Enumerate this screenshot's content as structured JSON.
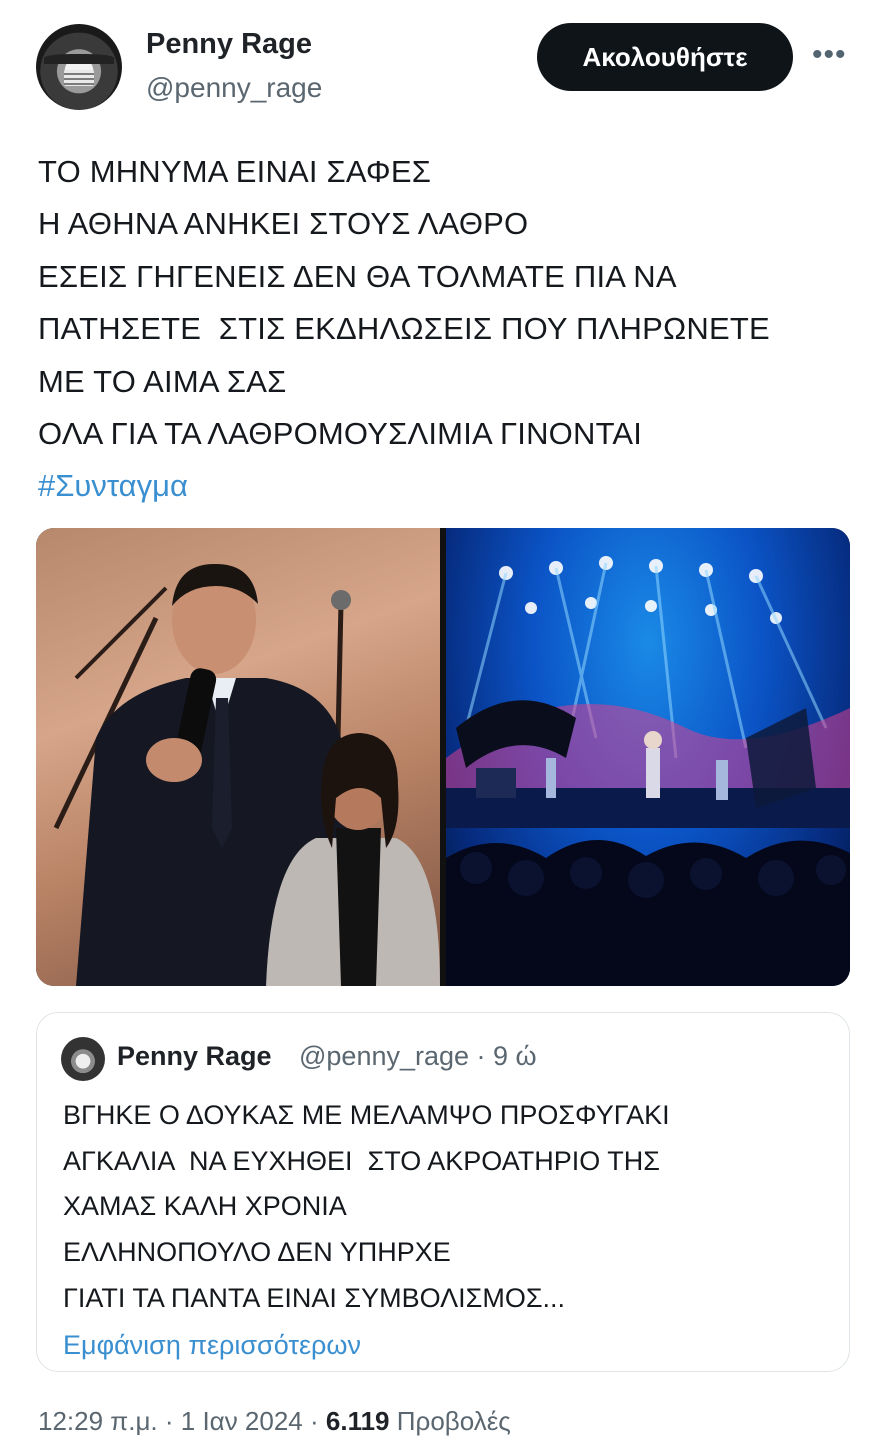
{
  "author": {
    "display_name": "Penny Rage",
    "handle": "@penny_rage",
    "follow_label": "Ακολουθήστε",
    "more_icon": "more-horizontal-icon"
  },
  "tweet": {
    "lines": [
      "ΤΟ ΜΗΝΥΜΑ ΕΙΝΑΙ ΣΑΦΕΣ",
      "Η ΑΘΗΝΑ ΑΝΗΚΕΙ ΣΤΟΥΣ ΛΑΘΡΟ",
      "ΕΣΕΙΣ ΓΗΓΕΝΕΙΣ ΔΕΝ ΘΑ ΤΟΛΜΑΤΕ ΠΙΑ ΝΑ",
      "ΠΑΤΗΣΕΤΕ  ΣΤΙΣ ΕΚΔΗΛΩΣΕΙΣ ΠΟΥ ΠΛΗΡΩΝΕΤΕ",
      "ΜΕ ΤΟ ΑΙΜΑ ΣΑΣ",
      "ΟΛΑ ΓΙΑ ΤΑ ΛΑΘΡΟΜΟΥΣΛΙΜΙΑ ΓΙΝΟΝΤΑΙ"
    ],
    "hashtag": "#Συνταγμα",
    "link_color": "#3a8fd0"
  },
  "quoted_tweet": {
    "display_name": "Penny Rage",
    "handle": "@penny_rage",
    "time": "9 ώ",
    "lines": [
      "ΒΓΗΚΕ Ο ΔΟΥΚΑΣ ΜΕ ΜΕΛΑΜΨΟ ΠΡΟΣΦΥΓΑΚΙ",
      "ΑΓΚΑΛΙΑ  ΝΑ ΕΥΧΗΘΕΙ  ΣΤΟ ΑΚΡΟΑΤΗΡΙΟ ΤΗΣ",
      "ΧΑΜΑΣ ΚΑΛΗ ΧΡΟΝΙΑ",
      "ΕΛΛΗΝΟΠΟΥΛΟ ΔΕΝ ΥΠΗΡΧΕ",
      "ΓΙΑΤΙ ΤΑ ΠΑΝΤΑ ΕΙΝΑΙ ΣΥΜΒΟΛΙΣΜΟΣ..."
    ],
    "show_more": "Εμφάνιση περισσότερων"
  },
  "footer": {
    "time": "12:29 π.μ.",
    "date": "1 Ιαν 2024",
    "views_count": "6.119",
    "views_label": "Προβολές"
  }
}
